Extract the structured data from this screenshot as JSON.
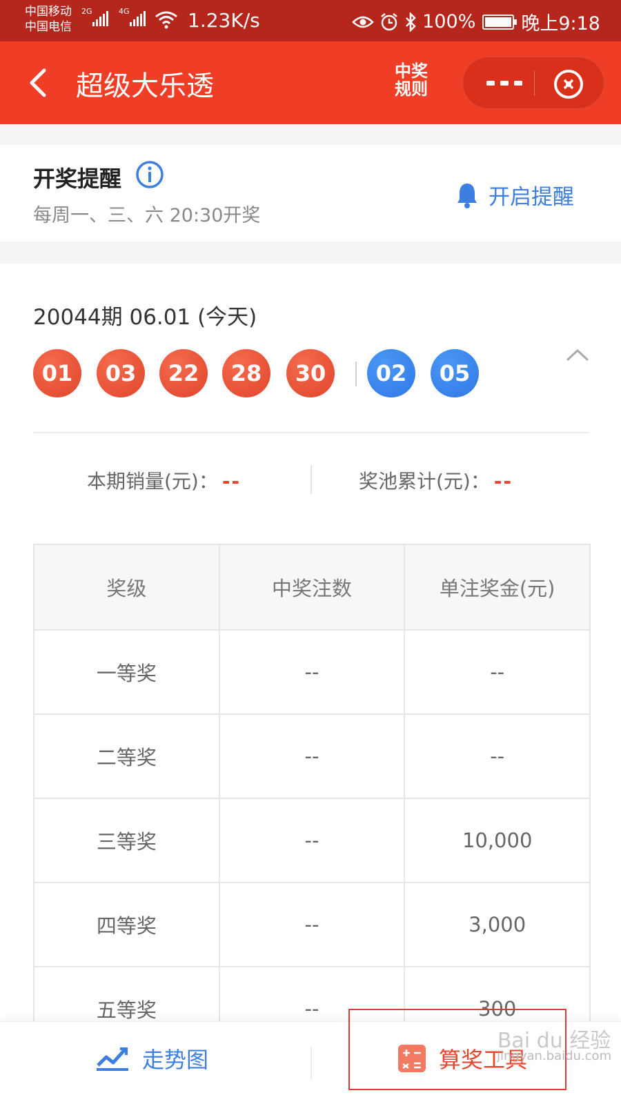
{
  "status_bar": {
    "carrier1": "中国移动",
    "carrier2": "中国电信",
    "net1": "2G",
    "net2": "4G",
    "speed": "1.23K/s",
    "battery": "100%",
    "time": "晚上9:18"
  },
  "header": {
    "title": "超级大乐透",
    "rules_line1": "中奖",
    "rules_line2": "规则"
  },
  "reminder": {
    "title": "开奖提醒",
    "schedule": "每周一、三、六 20:30开奖",
    "button_label": "开启提醒"
  },
  "draw": {
    "issue": "20044期 06.01 (今天)",
    "red_balls": [
      "01",
      "03",
      "22",
      "28",
      "30"
    ],
    "blue_balls": [
      "02",
      "05"
    ],
    "sales_label": "本期销量(元)：",
    "sales_value": "--",
    "pool_label": "奖池累计(元)：",
    "pool_value": "--"
  },
  "prize_table": {
    "headers": [
      "奖级",
      "中奖注数",
      "单注奖金(元)"
    ],
    "rows": [
      [
        "一等奖",
        "--",
        "--"
      ],
      [
        "二等奖",
        "--",
        "--"
      ],
      [
        "三等奖",
        "--",
        "10,000"
      ],
      [
        "四等奖",
        "--",
        "3,000"
      ],
      [
        "五等奖",
        "--",
        "300"
      ]
    ]
  },
  "bottom_bar": {
    "trend_label": "走势图",
    "calc_label": "算奖工具"
  },
  "watermark": {
    "line1": "Bai du 经验",
    "line2": "jingyan.baidu.com"
  },
  "colors": {
    "header_red": "#f03d25",
    "status_red": "#b5271c",
    "ball_red": "#e0452a",
    "ball_blue": "#2f77e6",
    "link_blue": "#3d7fe0"
  }
}
